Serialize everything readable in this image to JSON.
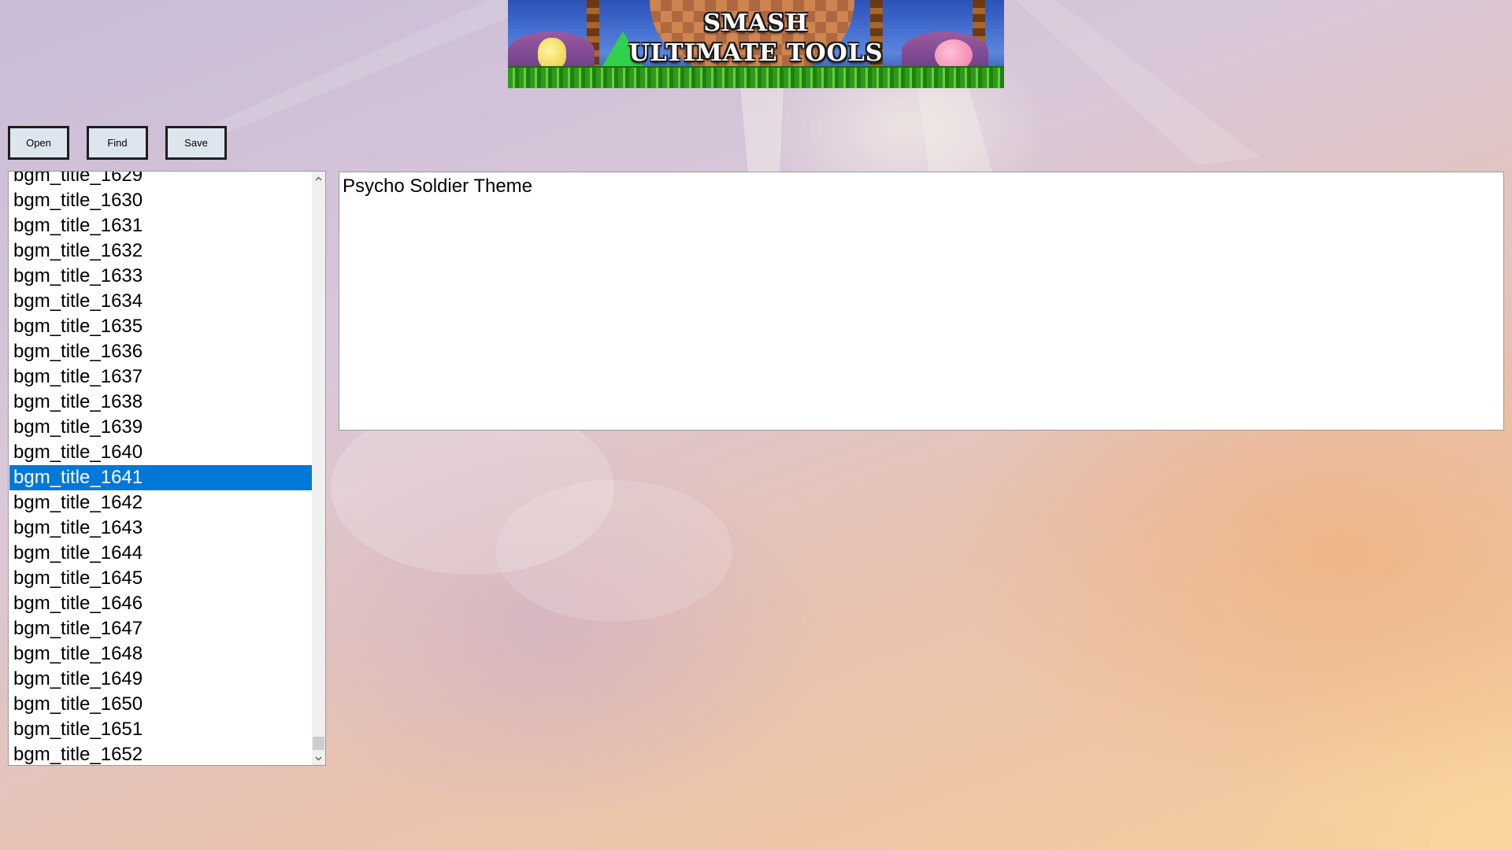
{
  "banner": {
    "line1": "SMASH",
    "line2": "ULTIMATE TOOLS"
  },
  "toolbar": {
    "open_label": "Open",
    "find_label": "Find",
    "save_label": "Save"
  },
  "bgm_list": {
    "items": [
      "bgm_title_1629",
      "bgm_title_1630",
      "bgm_title_1631",
      "bgm_title_1632",
      "bgm_title_1633",
      "bgm_title_1634",
      "bgm_title_1635",
      "bgm_title_1636",
      "bgm_title_1637",
      "bgm_title_1638",
      "bgm_title_1639",
      "bgm_title_1640",
      "bgm_title_1641",
      "bgm_title_1642",
      "bgm_title_1643",
      "bgm_title_1644",
      "bgm_title_1645",
      "bgm_title_1646",
      "bgm_title_1647",
      "bgm_title_1648",
      "bgm_title_1649",
      "bgm_title_1650",
      "bgm_title_1651",
      "bgm_title_1652"
    ],
    "selected": "bgm_title_1641",
    "selection_color": "#0078d7"
  },
  "editor": {
    "value": "Psycho Soldier Theme"
  },
  "icons": {
    "scroll_up": "chevron-up-icon",
    "scroll_down": "chevron-down-icon"
  }
}
